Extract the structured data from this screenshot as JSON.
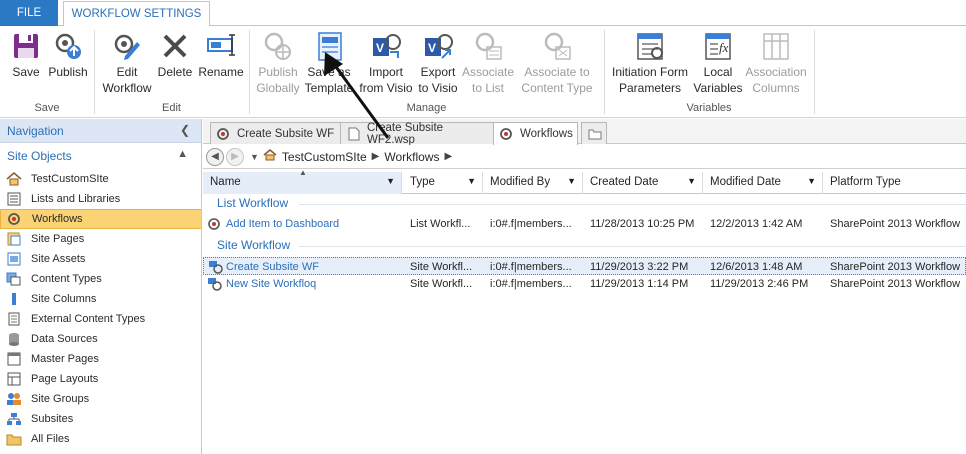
{
  "ribbon": {
    "tabs": [
      {
        "label": "FILE"
      },
      {
        "label": "WORKFLOW SETTINGS"
      }
    ],
    "groups": [
      {
        "label": "Save"
      },
      {
        "label": "Edit"
      },
      {
        "label": "Manage"
      },
      {
        "label": "Variables"
      }
    ],
    "buttons": [
      {
        "line1": "Save",
        "line2": "",
        "icon": "floppy-disk-icon",
        "enabled": true
      },
      {
        "line1": "Publish",
        "line2": "",
        "icon": "publish-icon",
        "enabled": true
      },
      {
        "line1": "Edit",
        "line2": "Workflow",
        "icon": "edit-workflow-icon",
        "enabled": true
      },
      {
        "line1": "Delete",
        "line2": "",
        "icon": "delete-x-icon",
        "enabled": true
      },
      {
        "line1": "Rename",
        "line2": "",
        "icon": "rename-icon",
        "enabled": true
      },
      {
        "line1": "Publish",
        "line2": "Globally",
        "icon": "publish-globally-icon",
        "enabled": false
      },
      {
        "line1": "Save as",
        "line2": "Template",
        "icon": "save-template-icon",
        "enabled": true
      },
      {
        "line1": "Import",
        "line2": "from Visio",
        "icon": "visio-import-icon",
        "enabled": true
      },
      {
        "line1": "Export",
        "line2": "to Visio",
        "icon": "visio-export-icon",
        "enabled": true
      },
      {
        "line1": "Associate",
        "line2": "to List",
        "icon": "associate-list-icon",
        "enabled": false
      },
      {
        "line1": "Associate to",
        "line2": "Content Type",
        "icon": "associate-content-type-icon",
        "enabled": false
      },
      {
        "line1": "Initiation Form",
        "line2": "Parameters",
        "icon": "initiation-form-icon",
        "enabled": true
      },
      {
        "line1": "Local",
        "line2": "Variables",
        "icon": "local-variables-icon",
        "enabled": true
      },
      {
        "line1": "Association",
        "line2": "Columns",
        "icon": "association-columns-icon",
        "enabled": false
      }
    ]
  },
  "navigation": {
    "title": "Navigation",
    "site_objects_title": "Site Objects",
    "items": [
      {
        "label": "TestCustomSIte",
        "icon": "home-icon"
      },
      {
        "label": "Lists and Libraries",
        "icon": "list-icon"
      },
      {
        "label": "Workflows",
        "icon": "workflow-icon",
        "selected": true
      },
      {
        "label": "Site Pages",
        "icon": "site-pages-icon"
      },
      {
        "label": "Site Assets",
        "icon": "site-assets-icon"
      },
      {
        "label": "Content Types",
        "icon": "content-types-icon"
      },
      {
        "label": "Site Columns",
        "icon": "site-columns-icon"
      },
      {
        "label": "External Content Types",
        "icon": "external-content-types-icon"
      },
      {
        "label": "Data Sources",
        "icon": "data-sources-icon"
      },
      {
        "label": "Master Pages",
        "icon": "master-pages-icon"
      },
      {
        "label": "Page Layouts",
        "icon": "page-layouts-icon"
      },
      {
        "label": "Site Groups",
        "icon": "site-groups-icon"
      },
      {
        "label": "Subsites",
        "icon": "subsites-icon"
      },
      {
        "label": "All Files",
        "icon": "folder-icon"
      }
    ]
  },
  "doc_tabs": [
    {
      "label": "Create Subsite WF",
      "icon": "workflow-icon"
    },
    {
      "label": "Create Subsite WF2.wsp",
      "icon": "file-icon"
    },
    {
      "label": "Workflows",
      "icon": "workflow-icon",
      "active": true
    }
  ],
  "breadcrumb": [
    "TestCustomSIte",
    "Workflows"
  ],
  "grid": {
    "columns": [
      "Name",
      "Type",
      "Modified By",
      "Created Date",
      "Modified Date",
      "Platform Type"
    ],
    "groups": [
      {
        "label": "List Workflow",
        "rows": [
          {
            "name": "Add Item to Dashboard",
            "type": "List Workfl...",
            "modified_by": "i:0#.f|members...",
            "created": "11/28/2013 10:25 PM",
            "modified": "12/2/2013 1:42 AM",
            "platform": "SharePoint 2013 Workflow"
          }
        ]
      },
      {
        "label": "Site Workflow",
        "rows": [
          {
            "name": "Create Subsite WF",
            "type": "Site Workfl...",
            "modified_by": "i:0#.f|members...",
            "created": "11/29/2013 3:22 PM",
            "modified": "12/6/2013 1:48 AM",
            "platform": "SharePoint 2013 Workflow",
            "selected": true
          },
          {
            "name": "New Site Workfloq",
            "type": "Site Workfl...",
            "modified_by": "i:0#.f|members...",
            "created": "11/29/2013 1:14 PM",
            "modified": "11/29/2013 2:46 PM",
            "platform": "SharePoint 2013 Workflow"
          }
        ]
      }
    ]
  },
  "colors": {
    "accent": "#2b78c5",
    "link": "#2b6fb6",
    "selection": "#fcd374"
  }
}
